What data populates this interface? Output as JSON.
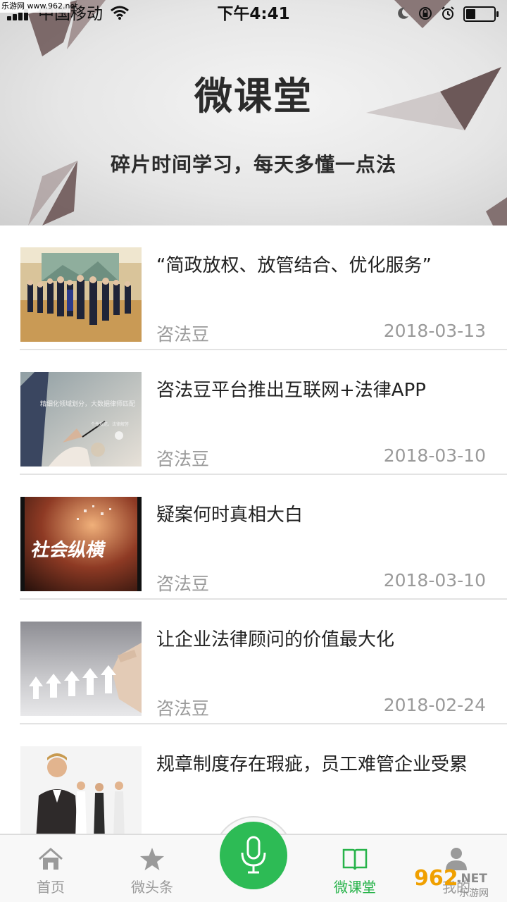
{
  "watermark_top": "乐游网 www.962.net",
  "watermark_bottom": {
    "brand": "962",
    "suffix": ".NET",
    "tag": "乐游网"
  },
  "status_bar": {
    "carrier": "中国移动",
    "time": "下午4:41",
    "battery_level": 0.35,
    "icons": [
      "signal-icon",
      "wifi-icon",
      "moon-icon",
      "rotation-lock-icon",
      "alarm-icon",
      "battery-icon"
    ]
  },
  "banner": {
    "title": "微课堂",
    "subtitle": "碎片时间学习，每天多懂一点法"
  },
  "articles": [
    {
      "title": "“简政放权、放管结合、优化服务”",
      "source": "咨法豆",
      "date": "2018-03-13",
      "thumb_icon": "meeting-photo"
    },
    {
      "title": "咨法豆平台推出互联网+法律APP",
      "source": "咨法豆",
      "date": "2018-03-10",
      "thumb_icon": "business-photo",
      "thumb_text": {
        "line1": "精细化领域划分，大数据律师匹配",
        "line2": "个性规范，法律解答"
      }
    },
    {
      "title": "疑案何时真相大白",
      "source": "咨法豆",
      "date": "2018-03-10",
      "thumb_icon": "tv-show-photo",
      "thumb_text": {
        "line1": "社会纵横"
      }
    },
    {
      "title": "让企业法律顾问的价值最大化",
      "source": "咨法豆",
      "date": "2018-02-24",
      "thumb_icon": "arrows-photo"
    },
    {
      "title": "规章制度存在瑕疵，员工难管企业受累",
      "source": "",
      "date": "",
      "thumb_icon": "people-photo"
    }
  ],
  "tab_bar": {
    "tabs": [
      {
        "label": "首页",
        "icon": "home-icon",
        "active": false
      },
      {
        "label": "微头条",
        "icon": "star-icon",
        "active": false
      },
      {
        "label": "微课堂",
        "icon": "book-icon",
        "active": true
      },
      {
        "label": "我的",
        "icon": "user-icon",
        "active": false
      }
    ],
    "center_icon": "microphone-icon",
    "accent_color": "#27b34a",
    "inactive_color": "#9a9a9a"
  }
}
